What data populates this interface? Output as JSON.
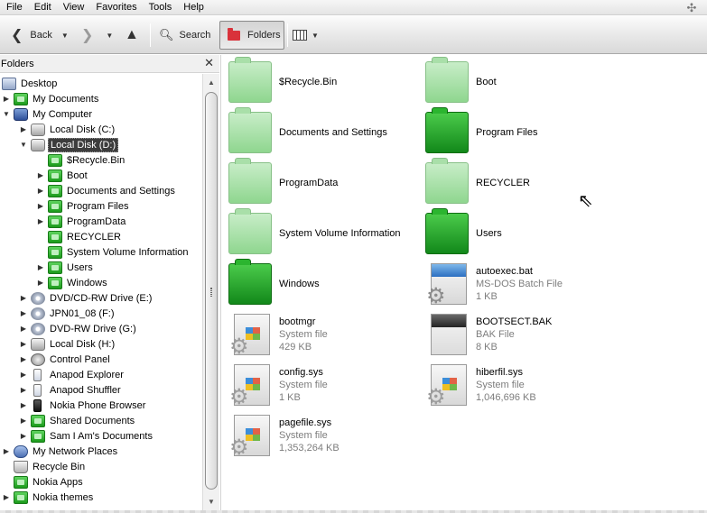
{
  "menu": [
    "File",
    "Edit",
    "View",
    "Favorites",
    "Tools",
    "Help"
  ],
  "toolbar": {
    "back_label": "Back",
    "search_label": "Search",
    "folders_label": "Folders"
  },
  "folders_pane": {
    "title": "Folders",
    "tree": [
      {
        "label": "Desktop",
        "icon": "desktop-icon"
      },
      {
        "label": "My Documents",
        "icon": "folder-icon"
      },
      {
        "label": "My Computer",
        "icon": "computer-icon"
      },
      {
        "label": "Local Disk (C:)",
        "icon": "drive-icon"
      },
      {
        "label": "Local Disk (D:)",
        "icon": "drive-icon",
        "selected": true
      },
      {
        "label": "$Recycle.Bin",
        "icon": "folder-icon"
      },
      {
        "label": "Boot",
        "icon": "folder-icon"
      },
      {
        "label": "Documents and Settings",
        "icon": "folder-icon"
      },
      {
        "label": "Program Files",
        "icon": "folder-icon"
      },
      {
        "label": "ProgramData",
        "icon": "folder-icon"
      },
      {
        "label": "RECYCLER",
        "icon": "folder-icon"
      },
      {
        "label": "System Volume Information",
        "icon": "folder-icon"
      },
      {
        "label": "Users",
        "icon": "folder-icon"
      },
      {
        "label": "Windows",
        "icon": "folder-icon"
      },
      {
        "label": "DVD/CD-RW Drive (E:)",
        "icon": "cd-drive-icon"
      },
      {
        "label": "JPN01_08 (F:)",
        "icon": "cd-drive-icon"
      },
      {
        "label": "DVD-RW Drive (G:)",
        "icon": "cd-drive-icon"
      },
      {
        "label": "Local Disk (H:)",
        "icon": "drive-icon"
      },
      {
        "label": "Control Panel",
        "icon": "control-panel-icon"
      },
      {
        "label": "Anapod Explorer",
        "icon": "ipod-icon"
      },
      {
        "label": "Anapod Shuffler",
        "icon": "ipod-icon"
      },
      {
        "label": "Nokia Phone Browser",
        "icon": "phone-icon"
      },
      {
        "label": "Shared Documents",
        "icon": "folder-icon"
      },
      {
        "label": "Sam I Am's Documents",
        "icon": "folder-icon"
      },
      {
        "label": "My Network Places",
        "icon": "network-icon"
      },
      {
        "label": "Recycle Bin",
        "icon": "recycle-bin-icon"
      },
      {
        "label": "Nokia Apps",
        "icon": "folder-icon"
      },
      {
        "label": "Nokia themes",
        "icon": "folder-icon"
      }
    ]
  },
  "files": [
    {
      "name": "$Recycle.Bin",
      "type": "",
      "size": "",
      "icon": "folder-icon"
    },
    {
      "name": "Boot",
      "type": "",
      "size": "",
      "icon": "folder-icon"
    },
    {
      "name": "Documents and Settings",
      "type": "",
      "size": "",
      "icon": "folder-icon"
    },
    {
      "name": "Program Files",
      "type": "",
      "size": "",
      "icon": "folder-icon"
    },
    {
      "name": "ProgramData",
      "type": "",
      "size": "",
      "icon": "folder-icon"
    },
    {
      "name": "RECYCLER",
      "type": "",
      "size": "",
      "icon": "folder-icon"
    },
    {
      "name": "System Volume Information",
      "type": "",
      "size": "",
      "icon": "folder-icon"
    },
    {
      "name": "Users",
      "type": "",
      "size": "",
      "icon": "folder-icon"
    },
    {
      "name": "Windows",
      "type": "",
      "size": "",
      "icon": "folder-icon"
    },
    {
      "name": "autoexec.bat",
      "type": "MS-DOS Batch File",
      "size": "1 KB",
      "icon": "batch-file-icon"
    },
    {
      "name": "bootmgr",
      "type": "System file",
      "size": "429 KB",
      "icon": "system-file-icon"
    },
    {
      "name": "BOOTSECT.BAK",
      "type": "BAK File",
      "size": "8 KB",
      "icon": "bak-file-icon"
    },
    {
      "name": "config.sys",
      "type": "System file",
      "size": "1 KB",
      "icon": "system-file-icon"
    },
    {
      "name": "hiberfil.sys",
      "type": "System file",
      "size": "1,046,696 KB",
      "icon": "system-file-icon"
    },
    {
      "name": "pagefile.sys",
      "type": "System file",
      "size": "1,353,264 KB",
      "icon": "system-file-icon"
    }
  ],
  "colors": {
    "folder_green": "#1c9b1c",
    "selection_bg": "#3d3d3d",
    "meta_text": "#7d7d7d"
  }
}
